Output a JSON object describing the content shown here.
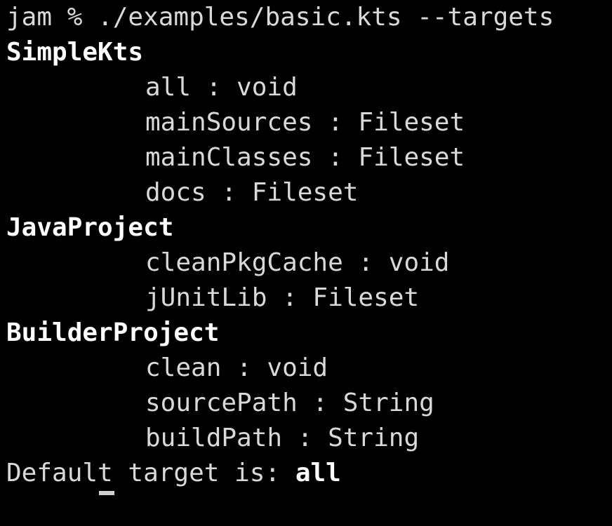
{
  "terminal": {
    "command_line": "jam % ./examples/basic.kts --targets",
    "groups": [
      {
        "name": "SimpleKts",
        "targets": [
          "all : void",
          "mainSources : Fileset",
          "mainClasses : Fileset",
          "docs : Fileset"
        ]
      },
      {
        "name": "JavaProject",
        "targets": [
          "cleanPkgCache : void",
          "jUnitLib : Fileset"
        ]
      },
      {
        "name": "BuilderProject",
        "targets": [
          "clean : void",
          "sourcePath : String",
          "buildPath : String"
        ]
      }
    ],
    "default_label": "Default target is: ",
    "default_value": "all"
  },
  "colors": {
    "background": "#000000",
    "text": "#d9d9d9",
    "bold_text": "#ffffff",
    "cursor": "#d0d0d0"
  }
}
